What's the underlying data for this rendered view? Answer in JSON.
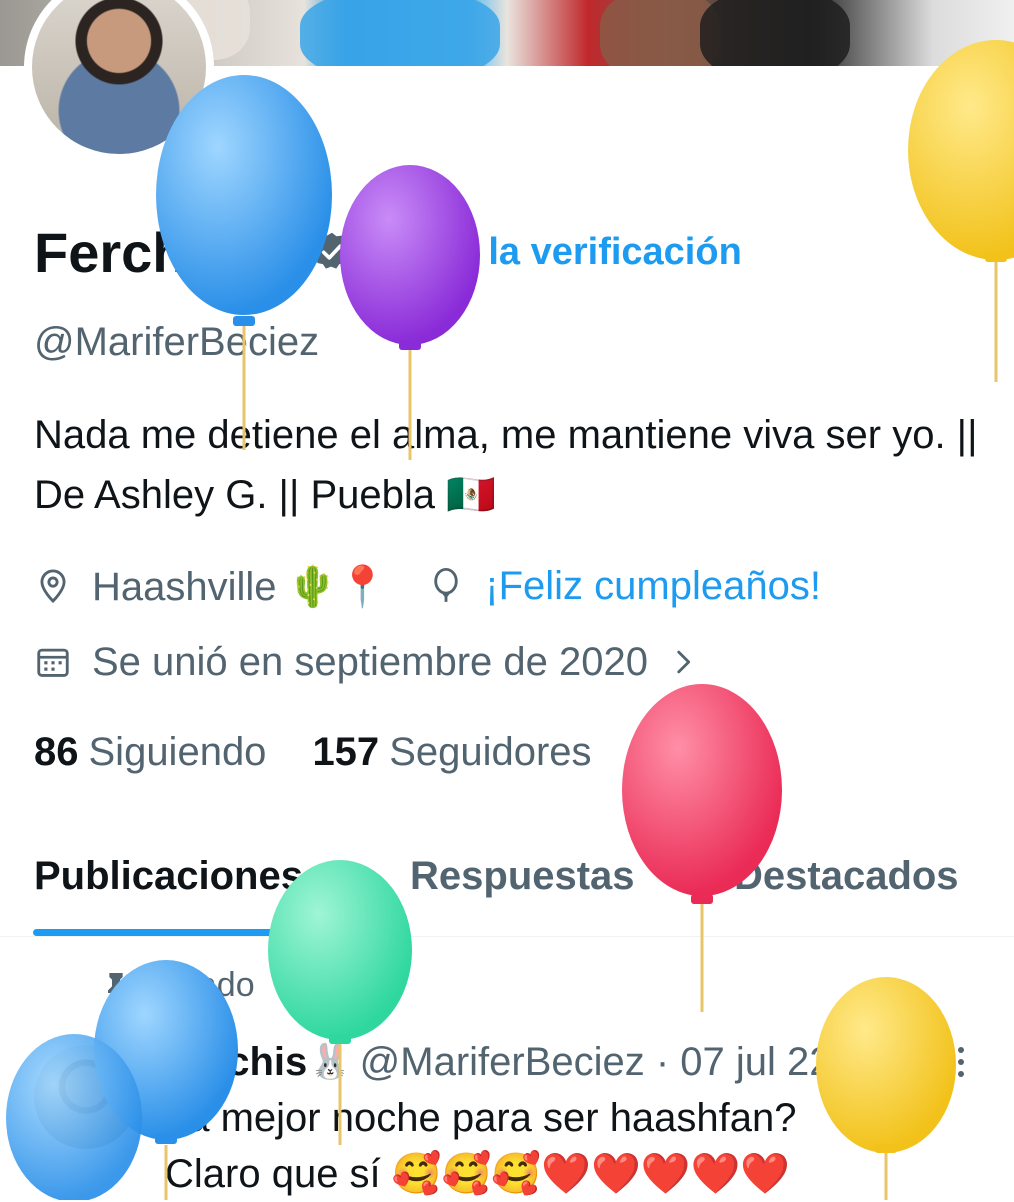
{
  "profile": {
    "name": "Ferchis",
    "name_emoji": "🐰",
    "verify_label": "Obtén la verificación",
    "handle": "@MariferBeciez",
    "bio": "Nada me detiene el alma, me mantiene viva ser yo. || De Ashley G. || Puebla 🇲🇽",
    "location": "Haashville 🌵📍",
    "birthday": "¡Feliz cumpleaños!",
    "joined": "Se unió en septiembre de 2020",
    "following_count": "86",
    "following_label": "Siguiendo",
    "followers_count": "157",
    "followers_label": "Seguidores"
  },
  "tabs": [
    {
      "label": "Publicaciones",
      "active": true
    },
    {
      "label": "Respuestas",
      "active": false
    },
    {
      "label": "Destacados",
      "active": false
    }
  ],
  "post": {
    "pinned_label": "Fijado",
    "author_name": "Ferchis",
    "author_emoji": "🐰",
    "meta": "@MariferBeciez · 07 jul 22",
    "text_line1": "La mejor noche para ser haashfan?",
    "text_line2": "Claro que sí 🥰🥰🥰❤️❤️❤️❤️❤️"
  },
  "colors": {
    "accent": "#1d9bf0",
    "text_primary": "#0f1419",
    "text_secondary": "#536471",
    "verify_badge": "#536471"
  },
  "icons": {
    "location": "location-pin-icon",
    "birthday": "balloon-icon",
    "calendar": "calendar-icon",
    "chevron": "chevron-right-icon",
    "pin": "pin-icon",
    "more": "more-vertical-icon",
    "verify": "verified-badge-icon"
  }
}
